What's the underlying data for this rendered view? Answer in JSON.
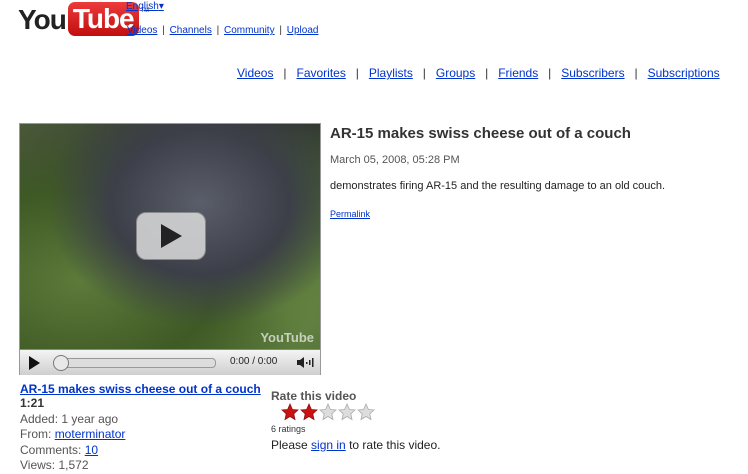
{
  "logo": {
    "you": "You",
    "tube": "Tube",
    "tm": "TM"
  },
  "language": {
    "label": "English",
    "arrow": "▾"
  },
  "top_nav": [
    "Videos",
    "Channels",
    "Community",
    "Upload"
  ],
  "top_nav_sep": "|",
  "tabs": [
    "Videos",
    "Favorites",
    "Playlists",
    "Groups",
    "Friends",
    "Subscribers",
    "Subscriptions"
  ],
  "tabs_sep": "|",
  "player": {
    "time": "0:00 / 0:00",
    "watermark": "YouTube"
  },
  "video": {
    "title": "AR-15 makes swiss cheese out of a couch",
    "date": "March 05, 2008, 05:28 PM",
    "description": "demonstrates firing AR-15 and the resulting damage to an old couch.",
    "permalink": "Permalink",
    "duration": "1:21",
    "added_label": "Added:",
    "added_value": "1 year ago",
    "from_label": "From:",
    "from_user": "moterminator",
    "comments_label": "Comments:",
    "comments_value": "10",
    "views_label": "Views:",
    "views_value": "1,572"
  },
  "rating": {
    "label": "Rate this video",
    "value": 2,
    "max": 5,
    "count_text": "6 ratings",
    "please": "Please",
    "sign_in": "sign in",
    "to_rate": "to rate this video."
  },
  "colors": {
    "link": "#0033cc",
    "star_on": "#cc1111",
    "star_off": "#dddddd",
    "logo_red": "#d41c1c"
  }
}
